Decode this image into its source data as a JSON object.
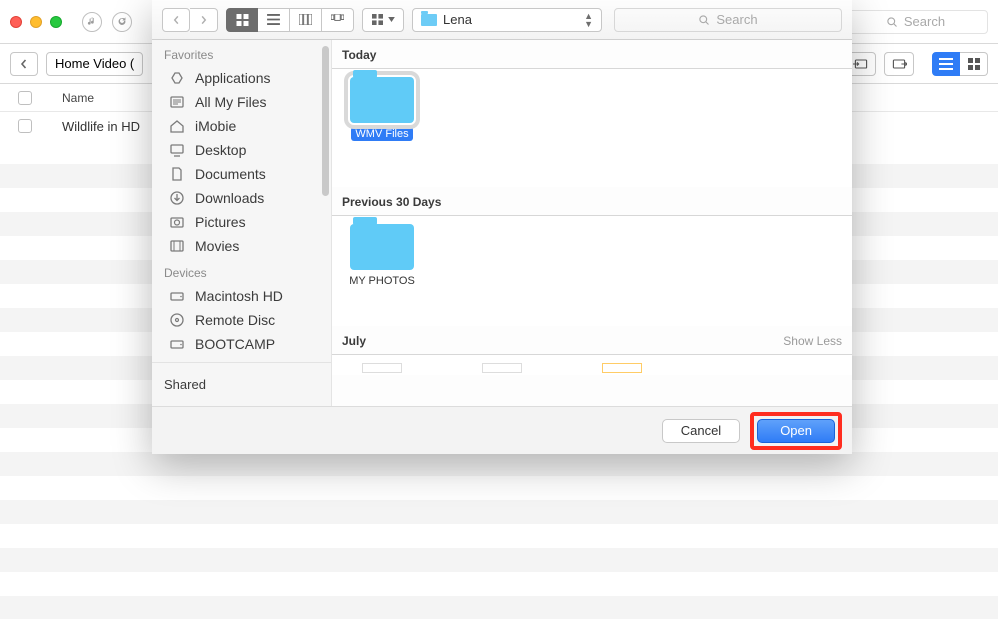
{
  "main_window": {
    "search_placeholder": "Search",
    "breadcrumb_label": "Home Video (",
    "column_name": "Name",
    "row1_title": "Wildlife in HD"
  },
  "dialog": {
    "location_label": "Lena",
    "search_placeholder": "Search",
    "sidebar": {
      "section_favorites": "Favorites",
      "favorites": [
        {
          "label": "Applications"
        },
        {
          "label": "All My Files"
        },
        {
          "label": "iMobie"
        },
        {
          "label": "Desktop"
        },
        {
          "label": "Documents"
        },
        {
          "label": "Downloads"
        },
        {
          "label": "Pictures"
        },
        {
          "label": "Movies"
        }
      ],
      "section_devices": "Devices",
      "devices": [
        {
          "label": "Macintosh HD"
        },
        {
          "label": "Remote Disc"
        },
        {
          "label": "BOOTCAMP"
        }
      ],
      "section_shared": "Shared"
    },
    "groups": {
      "today": {
        "title": "Today",
        "items": [
          {
            "name": "WMV Files",
            "selected": true
          }
        ]
      },
      "prev30": {
        "title": "Previous 30 Days",
        "items": [
          {
            "name": "MY PHOTOS",
            "selected": false
          }
        ]
      },
      "july": {
        "title": "July",
        "show_less": "Show Less"
      }
    },
    "buttons": {
      "cancel": "Cancel",
      "open": "Open"
    }
  }
}
